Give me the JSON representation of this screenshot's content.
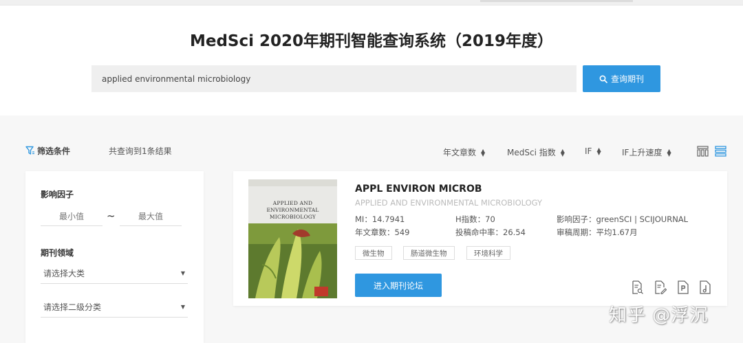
{
  "page_title": "MedSci 2020年期刊智能查询系统（2019年度）",
  "search": {
    "value": "applied environmental microbiology",
    "button_label": "查询期刊"
  },
  "filter_bar": {
    "filter_label": "筛选条件",
    "result_count": "共查询到1条结果",
    "sort_options": [
      "年文章数",
      "MedSci 指数",
      "IF",
      "IF上升速度"
    ]
  },
  "sidebar": {
    "impact_factor_title": "影响因子",
    "min_placeholder": "最小值",
    "max_placeholder": "最大值",
    "range_separator": "~",
    "field_title": "期刊领域",
    "category_select": "请选择大类",
    "subcategory_select": "请选择二级分类"
  },
  "journal": {
    "abbreviation": "APPL ENVIRON MICROB",
    "full_name": "APPLIED AND ENVIRONMENTAL MICROBIOLOGY",
    "cover_title_lines": [
      "APPLIED AND",
      "ENVIRONMENTAL",
      "MICROBIOLOGY"
    ],
    "metrics": {
      "mi": "MI：14.7941",
      "h_index": "H指数：70",
      "impact_factor": "影响因子：greenSCI | SCIJOURNAL",
      "articles_per_year": "年文章数：549",
      "acceptance_rate": "投稿命中率：26.54",
      "review_cycle": "审稿周期：平均1.67月"
    },
    "tags": [
      "微生物",
      "肠道微生物",
      "环境科学"
    ],
    "forum_button": "进入期刊论坛"
  },
  "watermark": "知乎 @浮沉",
  "colors": {
    "accent": "#2f97e0",
    "page_background": "#f7f7f7"
  }
}
